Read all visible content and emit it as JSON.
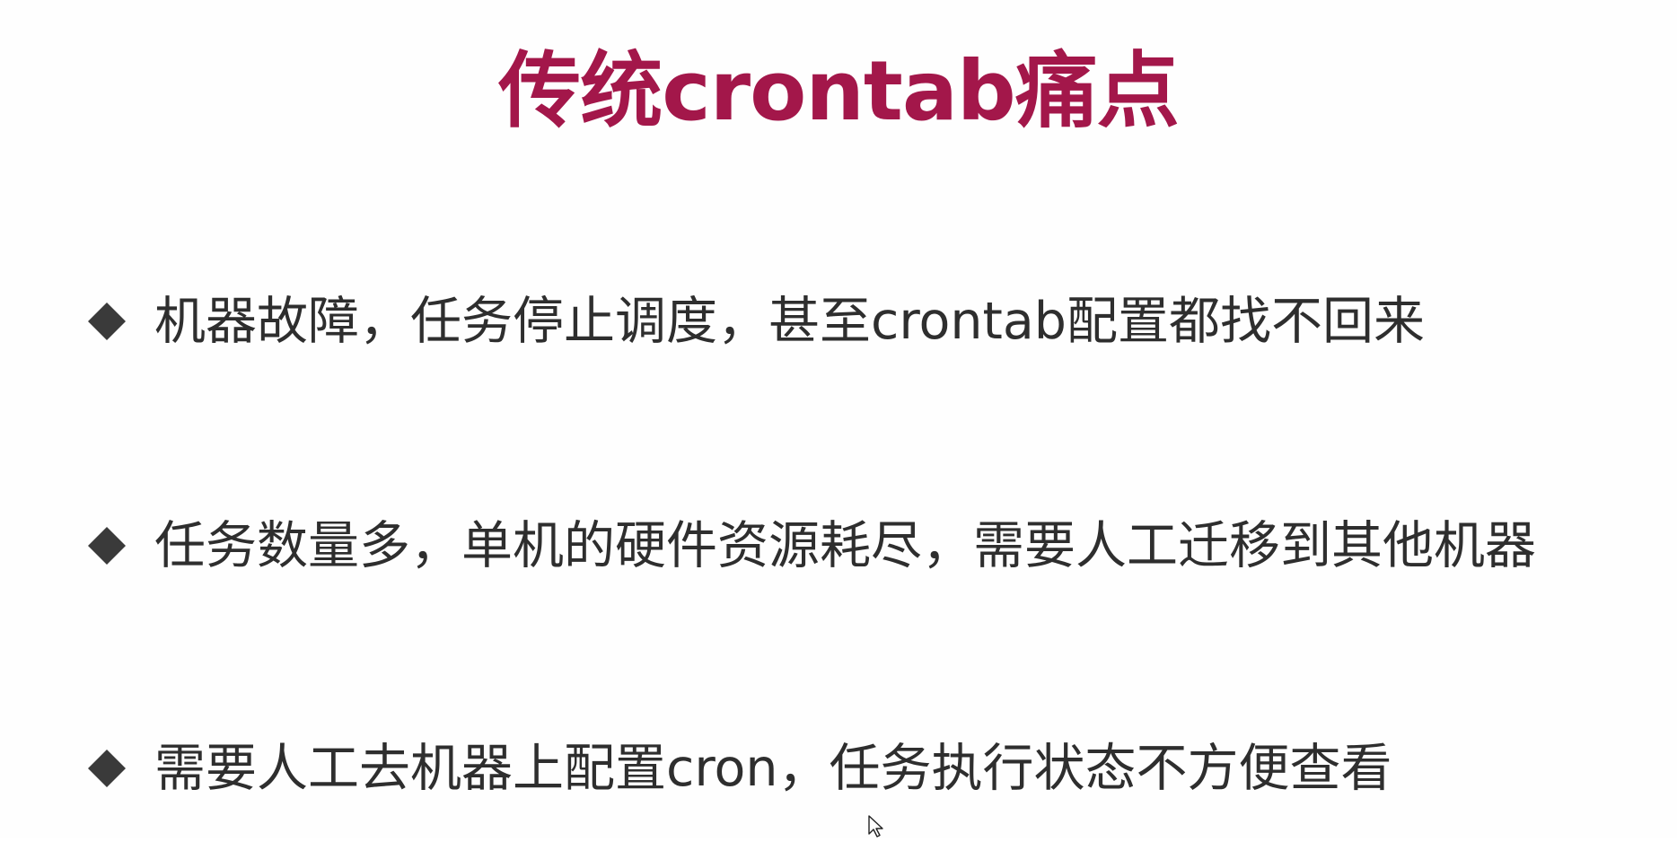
{
  "slide": {
    "title": "传统crontab痛点",
    "title_color": "#a3174a",
    "text_color": "#2e2e2e",
    "bullet_icon": "diamond-bullet-icon",
    "bullets": [
      {
        "text": "机器故障，任务停止调度，甚至crontab配置都找不回来"
      },
      {
        "text": "任务数量多，单机的硬件资源耗尽，需要人工迁移到其他机器"
      },
      {
        "text": "需要人工去机器上配置cron，任务执行状态不方便查看"
      }
    ]
  },
  "cursor_icon": "mouse-pointer-icon"
}
